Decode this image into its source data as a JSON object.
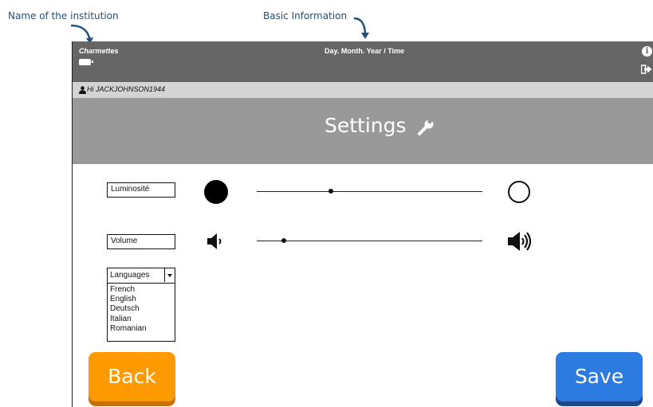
{
  "annotations": {
    "institution": "Name of the institution",
    "basic_info": "Basic Information"
  },
  "topbar": {
    "institution_name": "Charmettes",
    "datetime": "Day. Month. Year / Time",
    "icons": [
      "battery-icon",
      "info-icon",
      "logout-icon"
    ]
  },
  "userbar": {
    "greeting": "Hi JACKJOHNSON1944",
    "icon": "user-icon"
  },
  "header": {
    "title": "Settings",
    "icon": "wrench-icon"
  },
  "settings": {
    "brightness": {
      "label": "Luminosité",
      "value_fraction": 0.33,
      "min_icon": "dark-circle-icon",
      "max_icon": "light-circle-icon"
    },
    "volume": {
      "label": "Volume",
      "value_fraction": 0.12,
      "min_icon": "speaker-low-icon",
      "max_icon": "speaker-high-icon"
    },
    "language": {
      "selected": "Languages",
      "options": [
        "French",
        "English",
        "Deutsch",
        "Italian",
        "Romanian"
      ]
    }
  },
  "buttons": {
    "back": "Back",
    "save": "Save"
  },
  "colors": {
    "topbar": "#666666",
    "userbar": "#d4d4d4",
    "header": "#999999",
    "back_button": "#ff9900",
    "save_button": "#2b7be0",
    "annotation": "#1f4f7a"
  }
}
